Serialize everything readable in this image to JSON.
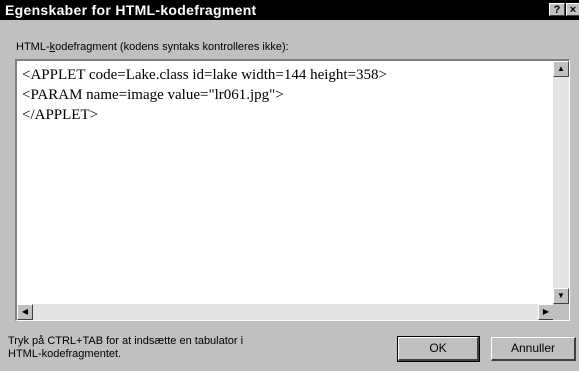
{
  "window": {
    "title": "Egenskaber for HTML-kodefragment",
    "help_glyph": "?",
    "close_glyph": "×"
  },
  "field": {
    "label_prefix": "HTML-",
    "label_mnemonic": "k",
    "label_rest": "odefragment (kodens syntaks kontrolleres ikke):",
    "lines": [
      "<APPLET code=Lake.class id=lake width=144 height=358>",
      "<PARAM name=image value=\"lr061.jpg\">",
      "</APPLET>"
    ]
  },
  "scrollbars": {
    "up_arrow": "▲",
    "down_arrow": "▼",
    "left_arrow": "◀",
    "right_arrow": "▶"
  },
  "footer": {
    "hint_line1": "Tryk på CTRL+TAB for at indsætte en tabulator i",
    "hint_line2": "HTML-kodefragmentet.",
    "ok_label": "OK",
    "cancel_label": "Annuller"
  }
}
